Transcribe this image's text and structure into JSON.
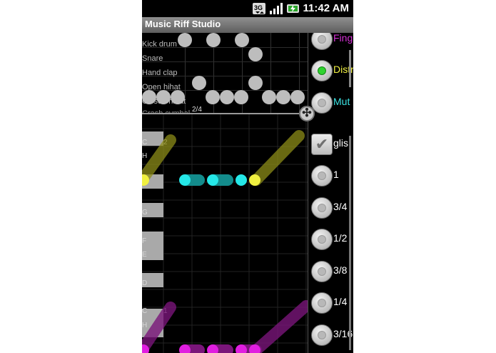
{
  "status_bar": {
    "time": "11:42 AM",
    "icons": [
      "3g-data-icon",
      "signal-icon",
      "battery-charging-icon"
    ]
  },
  "app": {
    "title": "Music Riff Studio"
  },
  "drum": {
    "tracks": [
      "Kick drum",
      "Snare",
      "Hand clap",
      "Open hihat",
      "Closed hihat",
      "Crash cymbal"
    ],
    "time_signature": "2/4"
  },
  "pitch": {
    "note_labels": [
      "C",
      "H",
      "2",
      "G",
      "F",
      "E",
      "D",
      "C",
      "H",
      "1"
    ]
  },
  "panel": {
    "effects": [
      {
        "label": "Fing",
        "color": "#d531d5",
        "selected": false
      },
      {
        "label": "Distr",
        "color": "#f2f243",
        "selected": true
      },
      {
        "label": "Mut",
        "color": "#3ce3e3",
        "selected": false
      }
    ],
    "glissando": {
      "label": "glis",
      "checked": true
    },
    "lengths": [
      {
        "label": "1"
      },
      {
        "label": "3/4"
      },
      {
        "label": "1/2"
      },
      {
        "label": "3/8"
      },
      {
        "label": "1/4"
      },
      {
        "label": "3/16"
      }
    ]
  },
  "colors": {
    "yellow_note": "#f0f040",
    "cyan_note": "#25e8e8",
    "magenta_note": "#e01ee0",
    "drum_dot": "#bdbdbd",
    "selected_radio": "#2fd32f"
  }
}
